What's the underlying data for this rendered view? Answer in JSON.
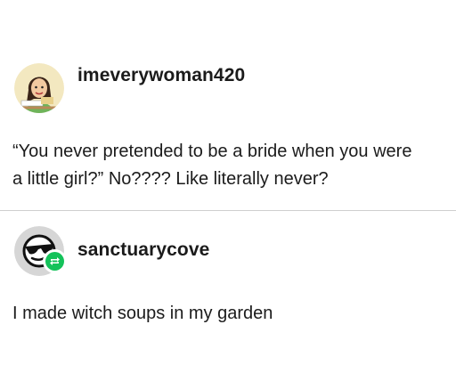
{
  "posts": [
    {
      "username": "imeverywoman420",
      "avatar_icon": "cartoon-woman-avatar-icon",
      "text_lines": [
        "“You never pretended to be a bride when you were",
        "a little girl?”  No???? Like literally never?"
      ]
    },
    {
      "username": "sanctuarycove",
      "avatar_icon": "sunglasses-face-avatar-icon",
      "badge_icon": "reblog-icon",
      "text_lines": [
        "I made witch soups in my garden"
      ]
    }
  ],
  "colors": {
    "reblog_badge": "#14c25a",
    "divider": "#cfcfcf",
    "text": "#1b1b1b"
  }
}
